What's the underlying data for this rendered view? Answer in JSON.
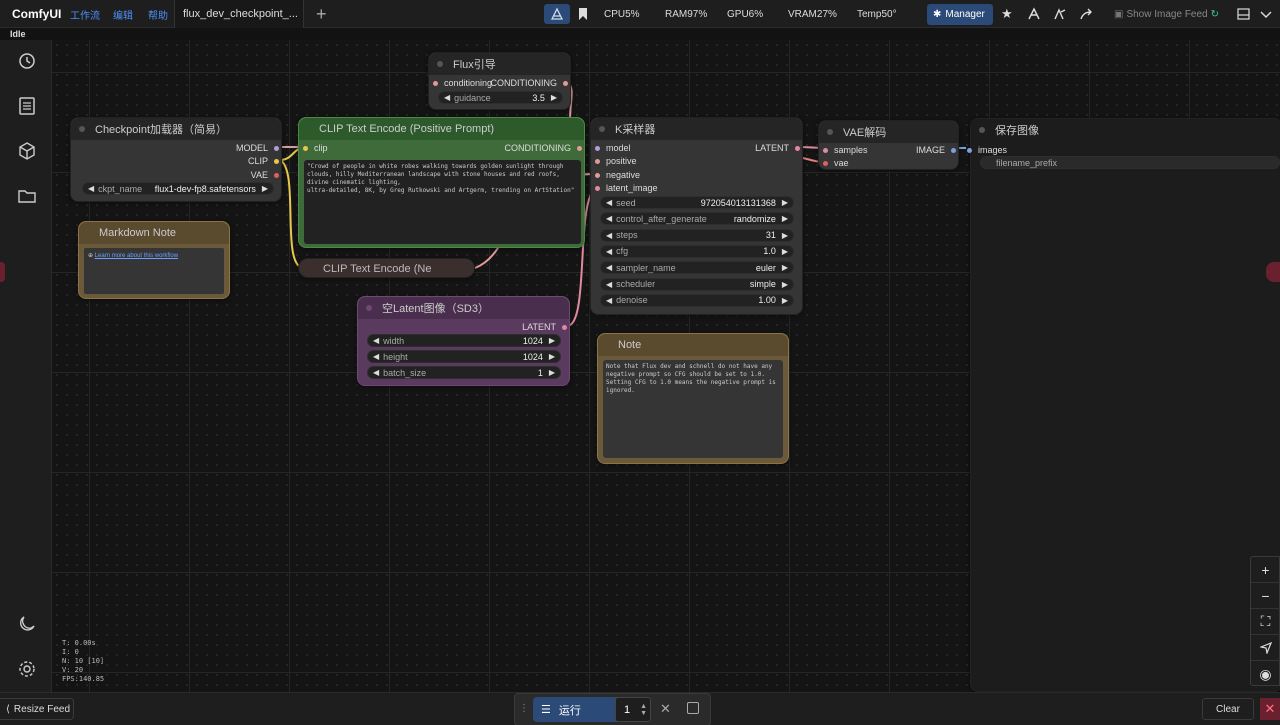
{
  "app": {
    "title": "ComfyUI",
    "status": "Idle"
  },
  "menu": [
    {
      "label": "工作流"
    },
    {
      "label": "编辑"
    },
    {
      "label": "帮助"
    }
  ],
  "tab": {
    "label": "flux_dev_checkpoint_..."
  },
  "stats": {
    "cpu": "CPU5%",
    "ram": "RAM97%",
    "gpu": "GPU6%",
    "vram": "VRAM27%",
    "temp": "Temp50°"
  },
  "toolbar": {
    "manager_label": "Manager",
    "show_image_feed": "Show Image Feed"
  },
  "nodes": {
    "checkpoint": {
      "title": "Checkpoint加载器（简易）",
      "out_model": "MODEL",
      "out_clip": "CLIP",
      "out_vae": "VAE",
      "ckpt_label": "ckpt_name",
      "ckpt_value": "flux1-dev-fp8.safetensors"
    },
    "flux_guidance": {
      "title": "Flux引导",
      "in_conditioning": "conditioning",
      "out_conditioning": "CONDITIONING",
      "guidance_label": "guidance",
      "guidance_value": "3.5"
    },
    "clip_pos": {
      "title": "CLIP Text Encode (Positive Prompt)",
      "in_clip": "clip",
      "out_conditioning": "CONDITIONING",
      "text": "\"Crowd of people in white robes walking towards golden sunlight through clouds, hilly Mediterranean landscape with stone houses and red roofs, divine cinematic lighting,\nultra-detailed, 8K, by Greg Rutkowski and Artgerm, trending on ArtStation\""
    },
    "clip_neg": {
      "title": "CLIP Text Encode (Ne"
    },
    "ksampler": {
      "title": "K采样器",
      "in_model": "model",
      "in_positive": "positive",
      "in_negative": "negative",
      "in_latent": "latent_image",
      "out_latent": "LATENT",
      "widgets": [
        {
          "label": "seed",
          "value": "972054013131368"
        },
        {
          "label": "control_after_generate",
          "value": "randomize"
        },
        {
          "label": "steps",
          "value": "31"
        },
        {
          "label": "cfg",
          "value": "1.0"
        },
        {
          "label": "sampler_name",
          "value": "euler"
        },
        {
          "label": "scheduler",
          "value": "simple"
        },
        {
          "label": "denoise",
          "value": "1.00"
        }
      ]
    },
    "vae_decode": {
      "title": "VAE解码",
      "in_samples": "samples",
      "in_vae": "vae",
      "out_image": "IMAGE"
    },
    "save_image": {
      "title": "保存图像",
      "in_images": "images",
      "prefix_label": "filename_prefix"
    },
    "markdown_note": {
      "title": "Markdown Note",
      "link": "Learn more about this workflow"
    },
    "latent": {
      "title": "空Latent图像（SD3）",
      "out_latent": "LATENT",
      "widgets": [
        {
          "label": "width",
          "value": "1024"
        },
        {
          "label": "height",
          "value": "1024"
        },
        {
          "label": "batch_size",
          "value": "1"
        }
      ]
    },
    "note": {
      "title": "Note",
      "text": "Note that Flux dev and schnell do not have any negative prompt so CFG should be set to 1.0.\nSetting CFG to 1.0 means the negative prompt is ignored."
    }
  },
  "perf": {
    "t": "T: 0.00s",
    "i": "I: 0",
    "n": "N: 10 [10]",
    "v": "V: 20",
    "fps": "FPS:140.85"
  },
  "bottom": {
    "resize_feed": "Resize Feed",
    "run_label": "运行",
    "batch_count": "1",
    "clear_label": "Clear"
  },
  "colors": {
    "accent": "#2c4a78",
    "clip_node": "#3f6b3a",
    "latent_node": "#5a3a5e",
    "note_node": "#6b5a3a"
  }
}
